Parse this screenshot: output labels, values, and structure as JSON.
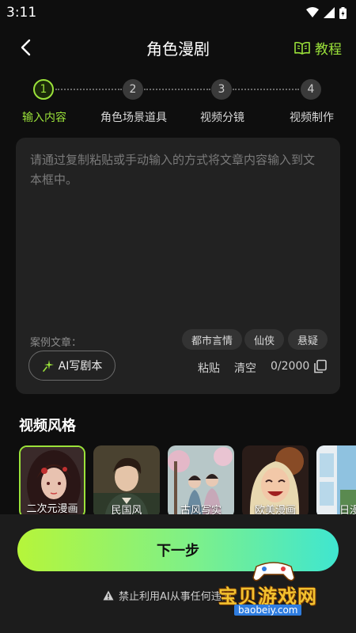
{
  "status_bar": {
    "time": "3:11"
  },
  "header": {
    "title": "角色漫剧",
    "tutorial_label": "教程"
  },
  "steps": [
    {
      "number": "1",
      "label": "输入内容",
      "active": true
    },
    {
      "number": "2",
      "label": "角色场景道具",
      "active": false
    },
    {
      "number": "3",
      "label": "视频分镜",
      "active": false
    },
    {
      "number": "4",
      "label": "视频制作",
      "active": false
    }
  ],
  "editor": {
    "placeholder": "请通过复制粘贴或手动输入的方式将文章内容输入到文本框中。",
    "example_label": "案例文章：",
    "example_tags": [
      "都市言情",
      "仙侠",
      "悬疑"
    ],
    "ai_script_label": "AI写剧本",
    "paste_label": "粘贴",
    "clear_label": "清空",
    "char_count": "0/2000"
  },
  "video_style": {
    "section_title": "视频风格",
    "options": [
      {
        "label": "二次元漫画",
        "selected": true
      },
      {
        "label": "民国风",
        "selected": false
      },
      {
        "label": "古风写实",
        "selected": false
      },
      {
        "label": "欧美漫画",
        "selected": false
      },
      {
        "label": "日漫",
        "selected": false
      }
    ]
  },
  "footer": {
    "next_label": "下一步",
    "notice": "禁止利用AI从事任何违法"
  },
  "watermark": {
    "text": "宝贝游戏网",
    "url": "baobeiy.com"
  },
  "colors": {
    "accent": "#9be23a",
    "background": "#0e0e0e",
    "panel": "#222222"
  }
}
